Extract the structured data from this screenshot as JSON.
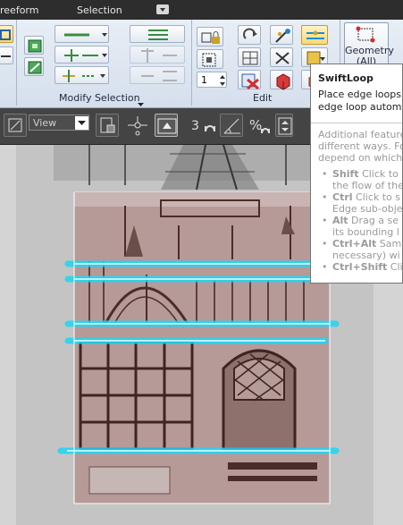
{
  "header": {
    "tabs": [
      {
        "label": "reeform"
      },
      {
        "label": "Selection"
      }
    ]
  },
  "ribbon": {
    "groups": [
      {
        "label": "Modify Selection"
      },
      {
        "label": "Edit"
      }
    ],
    "spinner_value": "1",
    "geometry_button": {
      "line1": "Geometry",
      "line2": "(All)"
    }
  },
  "command_bar": {
    "view_select": "View",
    "count_label": "3",
    "percent_label": "%"
  },
  "tooltip": {
    "title": "SwiftLoop",
    "description": [
      "Place edge loops by",
      "edge loop automatio"
    ],
    "more": [
      "Additional features i",
      "different ways. Follo",
      "depend on which ke"
    ],
    "items": [
      {
        "key": "Shift",
        "text": [
          " Click to",
          "the flow of the"
        ]
      },
      {
        "key": "Ctrl",
        "text": [
          " Click to s",
          "Edge sub-obje"
        ]
      },
      {
        "key": "Alt",
        "text": [
          " Drag a se",
          "its bounding l"
        ]
      },
      {
        "key": "Ctrl+Alt",
        "text": [
          " Sam",
          "necessary) wi"
        ]
      },
      {
        "key": "Ctrl+Shift",
        "text": [
          " Cli"
        ]
      }
    ]
  },
  "colors": {
    "ribbon_top": "#e8eef6",
    "ribbon_bottom": "#d5dfec",
    "edge_loop": "#1fd6f5",
    "highlight": "#fcd874"
  }
}
